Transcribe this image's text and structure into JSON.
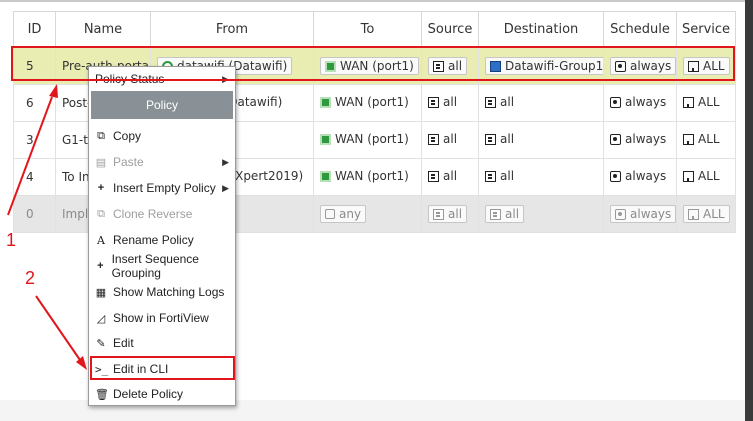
{
  "table": {
    "headers": [
      "ID",
      "Name",
      "From",
      "To",
      "Source",
      "Destination",
      "Schedule",
      "Service"
    ],
    "rows": [
      {
        "id": "5",
        "name": "Pre-auth-portal",
        "from": "datawifi (Datawifi)",
        "to": "WAN (port1)",
        "source": "all",
        "destination": "Datawifi-Group1",
        "schedule": "always",
        "service": "ALL"
      },
      {
        "id": "6",
        "name": "Post-auth-portal",
        "from": "datawifi (Datawifi)",
        "to": "WAN (port1)",
        "source": "all",
        "destination": "all",
        "schedule": "always",
        "service": "ALL"
      },
      {
        "id": "3",
        "name": "G1-to-Internet",
        "from": "",
        "to": "WAN (port1)",
        "source": "all",
        "destination": "all",
        "schedule": "always",
        "service": "ALL"
      },
      {
        "id": "4",
        "name": "To Internet",
        "from": "ITXpert (ITXpert2019)",
        "to": "WAN (port1)",
        "source": "all",
        "destination": "all",
        "schedule": "always",
        "service": "ALL"
      },
      {
        "id": "0",
        "name": "Implicit Deny",
        "from": "",
        "to": "any",
        "source": "all",
        "destination": "all",
        "schedule": "always",
        "service": "ALL"
      }
    ]
  },
  "context_menu": {
    "policy_status": "Policy Status",
    "header": "Policy",
    "items": [
      {
        "label": "Copy",
        "icon": "copy-icon"
      },
      {
        "label": "Paste",
        "icon": "paste-icon"
      },
      {
        "label": "Insert Empty Policy",
        "icon": "plus-icon"
      },
      {
        "label": "Clone Reverse",
        "icon": "clone-icon"
      },
      {
        "label": "Rename Policy",
        "icon": "rename-icon"
      },
      {
        "label": "Insert Sequence Grouping",
        "icon": "plus-icon"
      },
      {
        "label": "Show Matching Logs",
        "icon": "logs-icon"
      },
      {
        "label": "Show in FortiView",
        "icon": "chart-icon"
      },
      {
        "label": "Edit",
        "icon": "pencil-icon"
      },
      {
        "label": "Edit in CLI",
        "icon": "cli-icon"
      },
      {
        "label": "Delete Policy",
        "icon": "trash-icon"
      }
    ]
  },
  "annotations": {
    "label_1": "1",
    "label_2": "2",
    "color": "#e0161b"
  }
}
